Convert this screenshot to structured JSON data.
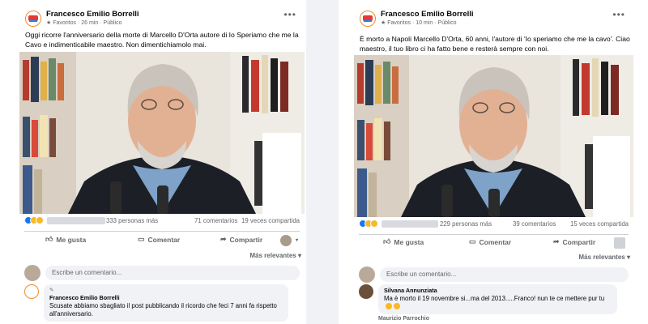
{
  "posts": [
    {
      "author": "Francesco Emilio Borrelli",
      "favorites_label": "Favoritos",
      "time": "26 min",
      "separator": "·",
      "visibility": "Público",
      "text": "Oggi ricorre l'anniversario della morte di Marcello D'Orta autore di Io Speriamo che me la Cavo e indimenticabile maestro. Non dimentichiamolo mai.",
      "reaction_count": "333 personas más",
      "comments_count": "71 comentarios",
      "shares_count": "19 veces compartida",
      "actions": {
        "like": "Me gusta",
        "comment": "Comentar",
        "share": "Compartir"
      },
      "sort_label": "Más relevantes",
      "composer_placeholder": "Escribe un comentario...",
      "comment": {
        "pinned_icon": "pencil-icon",
        "author": "Francesco Emilio Borrelli",
        "text": "Scusate abbiamo sbagliato il post pubblicando il ricordo che feci 7 anni fa rispetto all'anniversario."
      }
    },
    {
      "author": "Francesco Emilio Borrelli",
      "favorites_label": "Favoritos",
      "time": "10 min",
      "separator": "·",
      "visibility": "Público",
      "text": "È morto a Napoli Marcello D'Orta, 60 anni, l'autore di 'Io speriamo che me la cavo'. Ciao maestro, il tuo libro ci ha fatto bene e resterà sempre con noi.",
      "reaction_count": "229 personas más",
      "comments_count": "39 comentarios",
      "shares_count": "15 veces compartida",
      "actions": {
        "like": "Me gusta",
        "comment": "Comentar",
        "share": "Compartir"
      },
      "sort_label": "Más relevantes",
      "composer_placeholder": "Escribe un comentario...",
      "comment": {
        "author": "Silvana Annunziata",
        "text": "Ma è morto il 19 novembre si...ma del 2013.....Franco! nun te ce mettere pur tu"
      },
      "next_author_clipped": "Maurizio Parrochio"
    }
  ],
  "icons": {
    "like": "thumbs-up-icon",
    "comment": "speech-bubble-icon",
    "share": "share-arrow-icon",
    "more": "more-dots-icon",
    "favorite": "star-icon",
    "visibility": "globe-icon"
  },
  "colors": {
    "facebook_blue": "#1877f2",
    "secondary_text": "#65676b",
    "comment_bg": "#f0f2f5"
  }
}
